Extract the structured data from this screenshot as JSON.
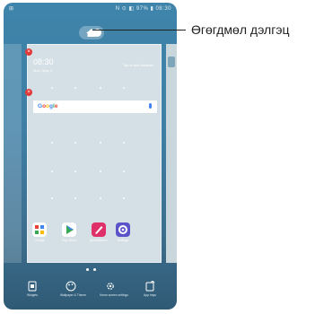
{
  "status": {
    "left": "⊞",
    "right": "N ⊙ ◧ 97% ▮ 08:30"
  },
  "widget": {
    "time": "08:30",
    "date": "Mon, May 4",
    "add_weather": "Tap to add weather"
  },
  "search": {
    "logo": "Google"
  },
  "apps": [
    {
      "label": "Google",
      "color": "#ffffff"
    },
    {
      "label": "Play Store",
      "color": "#ffffff"
    },
    {
      "label": "QuickMemo+",
      "color": "#e0306a"
    },
    {
      "label": "Settings",
      "color": "#5a54c8"
    }
  ],
  "toolbar": [
    {
      "label": "Widgets"
    },
    {
      "label": "Wallpaper & Theme"
    },
    {
      "label": "Home screen settings"
    },
    {
      "label": "App trays"
    }
  ],
  "callout": {
    "text": "Өгөгдмөл дэлгэц"
  }
}
